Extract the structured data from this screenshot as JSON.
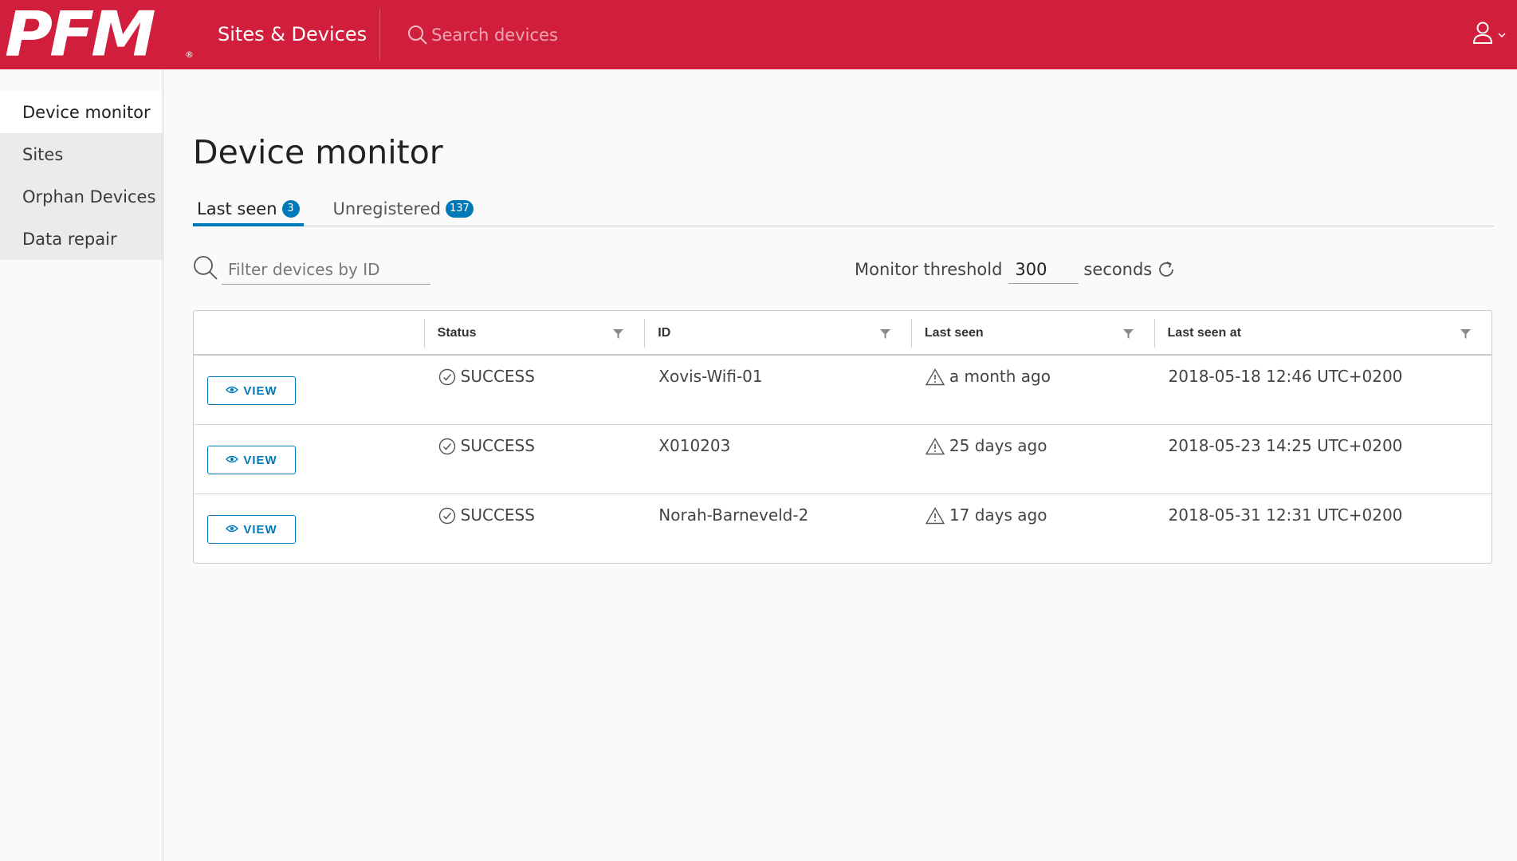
{
  "header": {
    "logo_text": "PFM",
    "logo_reg": "®",
    "nav_title": "Sites & Devices",
    "search_placeholder": "Search devices",
    "bg_color": "#d01e3c"
  },
  "sidebar": {
    "items": [
      {
        "label": "Device monitor",
        "active": true
      },
      {
        "label": "Sites"
      },
      {
        "label": "Orphan Devices"
      },
      {
        "label": "Data repair"
      }
    ]
  },
  "main": {
    "title": "Device monitor",
    "tabs": [
      {
        "label": "Last seen",
        "count": "3",
        "active": true
      },
      {
        "label": "Unregistered",
        "count": "137"
      }
    ],
    "filter_placeholder": "Filter devices by ID",
    "threshold": {
      "label": "Monitor threshold",
      "value": "300",
      "unit": "seconds"
    },
    "table": {
      "columns": [
        "",
        "Status",
        "ID",
        "Last seen",
        "Last seen at"
      ],
      "view_label": "VIEW",
      "rows": [
        {
          "status": "SUCCESS",
          "id": "Xovis-Wifi-01",
          "last_seen": "a month ago",
          "last_seen_at": "2018-05-18 12:46 UTC+0200"
        },
        {
          "status": "SUCCESS",
          "id": "X010203",
          "last_seen": "25 days ago",
          "last_seen_at": "2018-05-23 14:25 UTC+0200"
        },
        {
          "status": "SUCCESS",
          "id": "Norah-Barneveld-2",
          "last_seen": "17 days ago",
          "last_seen_at": "2018-05-31 12:31 UTC+0200"
        }
      ]
    }
  },
  "colors": {
    "accent": "#0079b8",
    "brand": "#d01e3c"
  },
  "icons": {
    "header_search": "search-icon",
    "user": "user-icon",
    "user_caret": "chevron-down-icon",
    "filter_search": "search-icon",
    "refresh": "refresh-icon",
    "column_filter": "filter-icon",
    "view": "eye-icon",
    "status": "check-circle-icon",
    "last_seen": "warning-icon"
  }
}
